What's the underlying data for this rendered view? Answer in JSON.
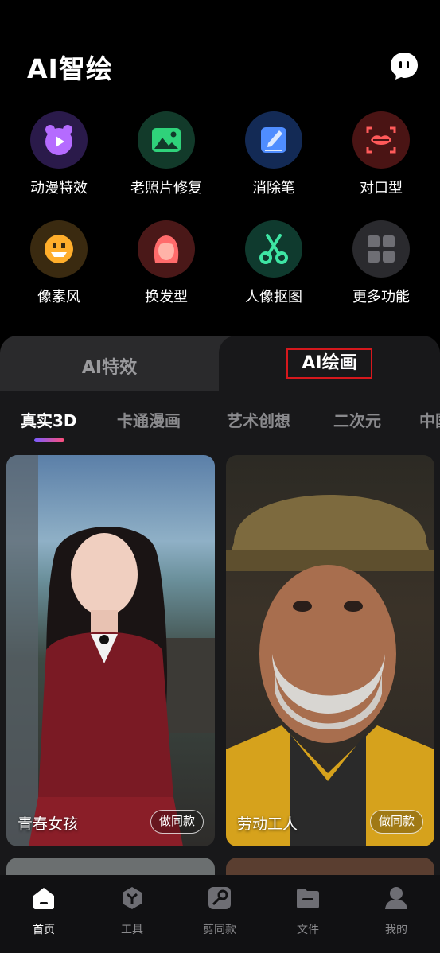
{
  "header": {
    "title": "AI智绘"
  },
  "tools": [
    {
      "label": "动漫特效",
      "icon": "anime-play-icon"
    },
    {
      "label": "老照片修复",
      "icon": "photo-restore-icon"
    },
    {
      "label": "消除笔",
      "icon": "eraser-pen-icon"
    },
    {
      "label": "对口型",
      "icon": "lip-sync-icon"
    },
    {
      "label": "像素风",
      "icon": "pixel-face-icon"
    },
    {
      "label": "换发型",
      "icon": "hairstyle-icon"
    },
    {
      "label": "人像抠图",
      "icon": "scissors-icon"
    },
    {
      "label": "更多功能",
      "icon": "grid-more-icon"
    }
  ],
  "segment": {
    "left": "AI特效",
    "right": "AI绘画",
    "selected": "AI绘画"
  },
  "categories": [
    "真实3D",
    "卡通漫画",
    "艺术创想",
    "二次元",
    "中国"
  ],
  "cards": [
    {
      "caption": "青春女孩",
      "action": "做同款"
    },
    {
      "caption": "劳动工人",
      "action": "做同款"
    }
  ],
  "nav": [
    {
      "label": "首页",
      "icon": "home-icon"
    },
    {
      "label": "工具",
      "icon": "tools-icon"
    },
    {
      "label": "剪同款",
      "icon": "clip-template-icon"
    },
    {
      "label": "文件",
      "icon": "folder-icon"
    },
    {
      "label": "我的",
      "icon": "profile-icon"
    }
  ],
  "colors": {
    "accent_red": "#d6181d",
    "panel": "#18181a",
    "background": "#000000"
  }
}
